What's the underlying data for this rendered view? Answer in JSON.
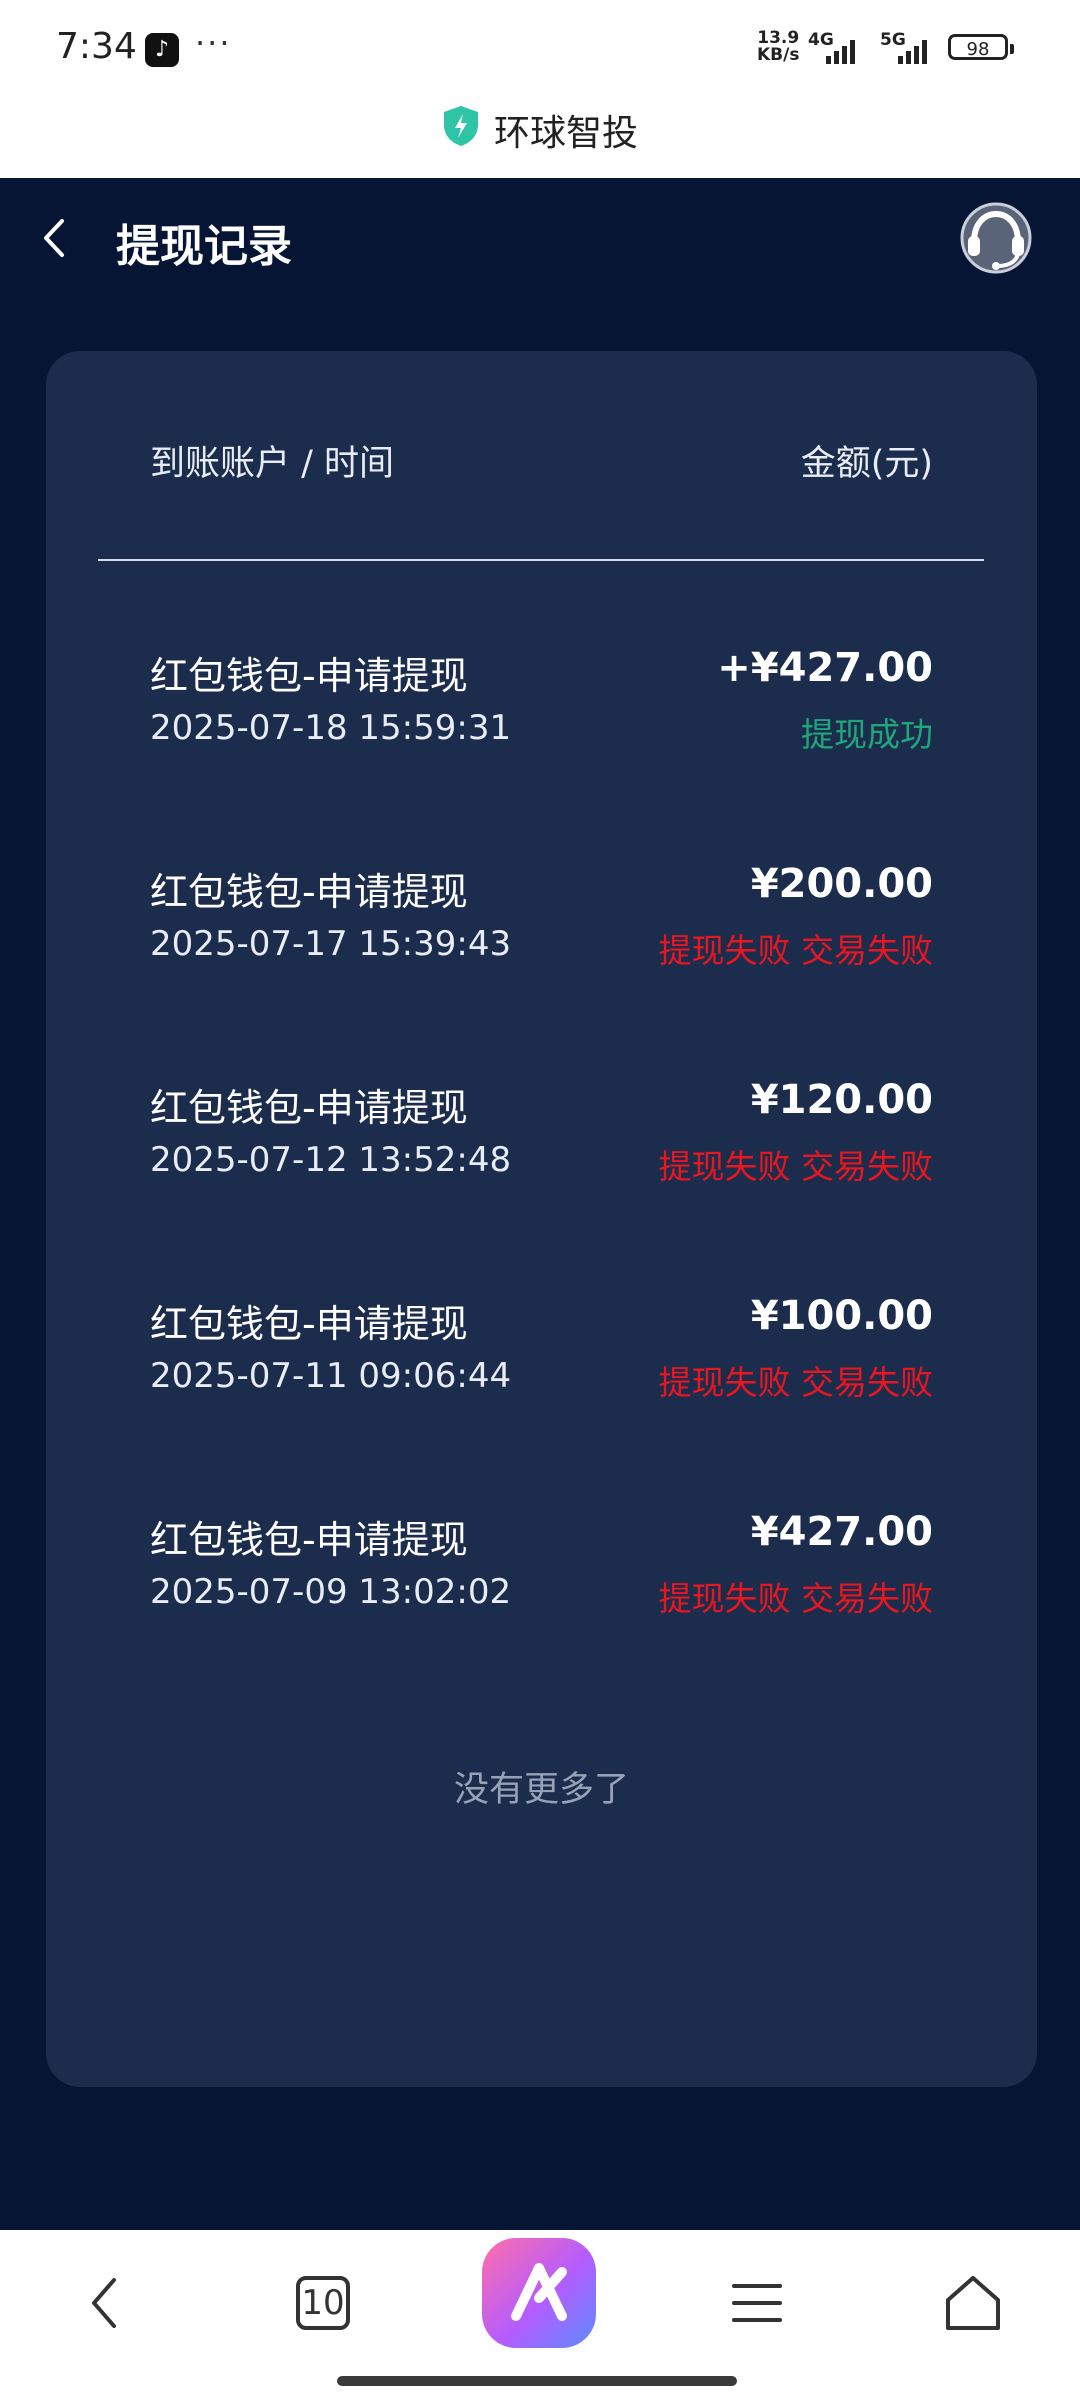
{
  "status_bar": {
    "time": "7:34",
    "more": "···",
    "speed_value": "13.9",
    "speed_unit": "KB/s",
    "net1": "4G",
    "net2": "5G",
    "battery": "98"
  },
  "site": {
    "title": "环球智投",
    "shield_color": "#2ec4a6"
  },
  "header": {
    "title": "提现记录"
  },
  "table": {
    "col_left": "到账账户 / 时间",
    "col_right": "金额(元)"
  },
  "records": [
    {
      "title": "红包钱包-申请提现",
      "time": "2025-07-18 15:59:31",
      "amount": "+¥427.00",
      "status": "提现成功",
      "status_color": "#1fa67a"
    },
    {
      "title": "红包钱包-申请提现",
      "time": "2025-07-17 15:39:43",
      "amount": "¥200.00",
      "status": "提现失败 交易失败",
      "status_color": "#e8161f"
    },
    {
      "title": "红包钱包-申请提现",
      "time": "2025-07-12 13:52:48",
      "amount": "¥120.00",
      "status": "提现失败 交易失败",
      "status_color": "#e8161f"
    },
    {
      "title": "红包钱包-申请提现",
      "time": "2025-07-11 09:06:44",
      "amount": "¥100.00",
      "status": "提现失败 交易失败",
      "status_color": "#e8161f"
    },
    {
      "title": "红包钱包-申请提现",
      "time": "2025-07-09 13:02:02",
      "amount": "¥427.00",
      "status": "提现失败 交易失败",
      "status_color": "#e8161f"
    }
  ],
  "footer_text": "没有更多了",
  "bottom_nav": {
    "tab_count": "10"
  },
  "colors": {
    "background": "#071534",
    "card": "#1c2c4d"
  }
}
